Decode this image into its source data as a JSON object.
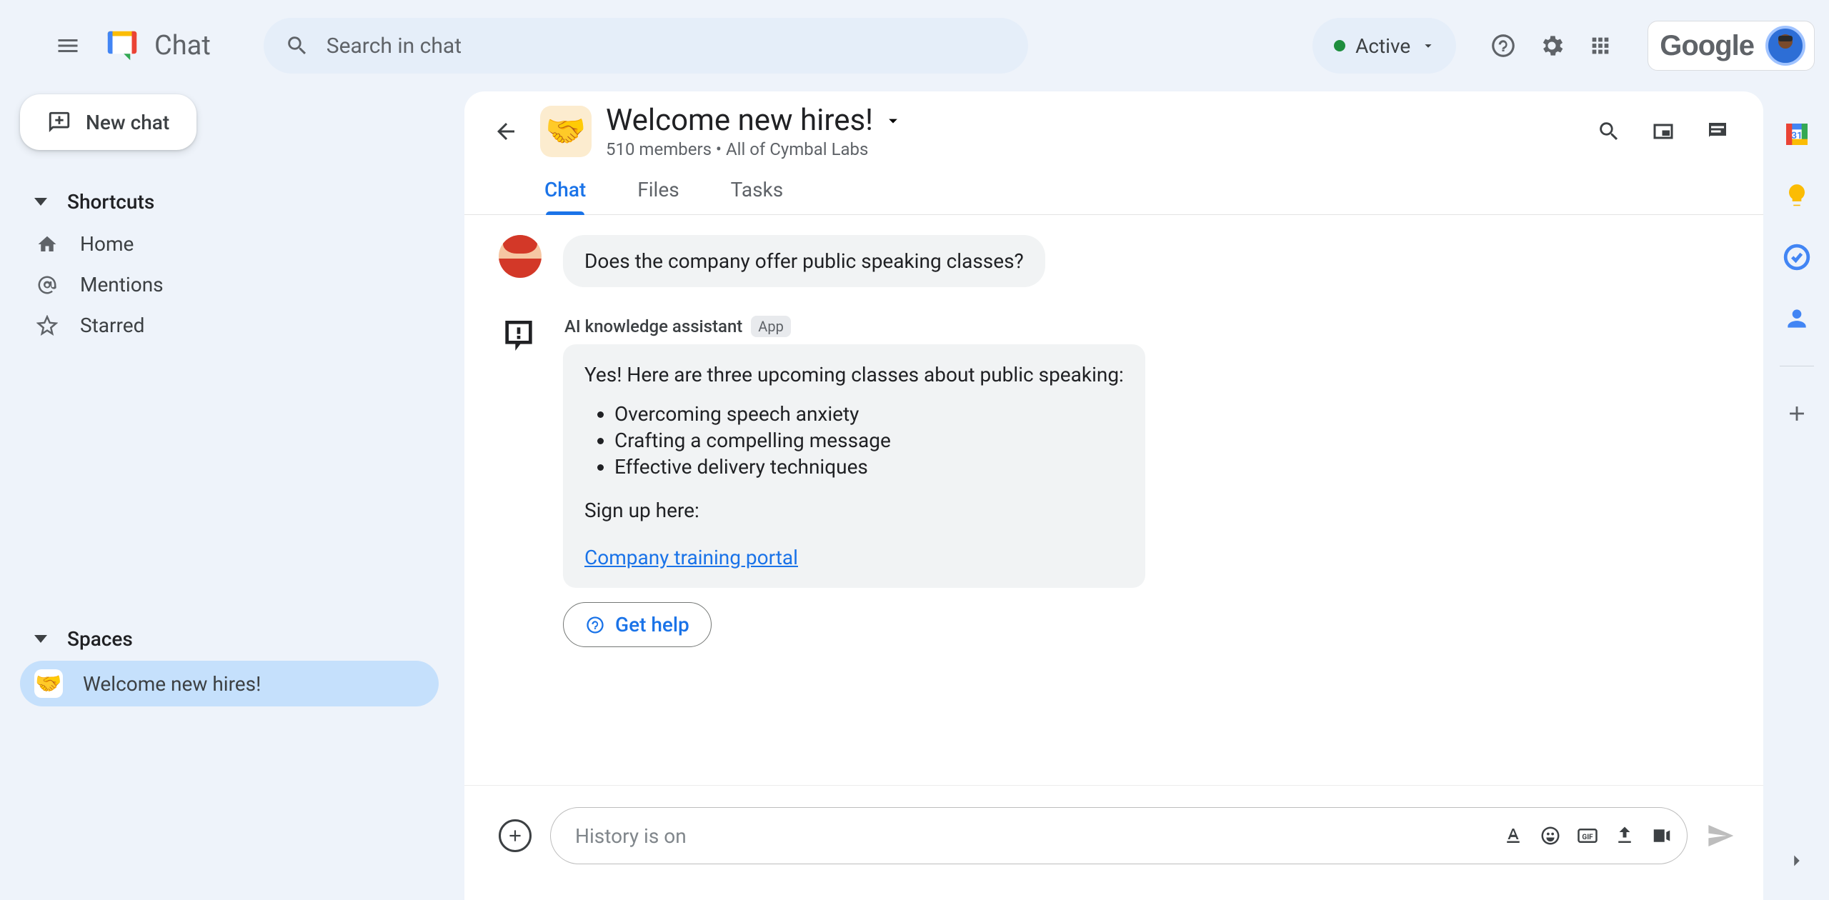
{
  "header": {
    "brand": "Chat",
    "search_placeholder": "Search in chat",
    "status_label": "Active",
    "google_word": "Google"
  },
  "left": {
    "new_chat": "New chat",
    "shortcuts_label": "Shortcuts",
    "shortcut_items": [
      "Home",
      "Mentions",
      "Starred"
    ],
    "spaces_label": "Spaces",
    "spaces": [
      {
        "emoji": "🤝",
        "name": "Welcome new hires!",
        "selected": true
      }
    ]
  },
  "space": {
    "emoji": "🤝",
    "title": "Welcome new hires!",
    "subtitle": "510 members  •  All of Cymbal Labs",
    "tabs": [
      "Chat",
      "Files",
      "Tasks"
    ],
    "active_tab": 0
  },
  "thread": {
    "user_msg": "Does the company offer public speaking classes?",
    "bot_name": "AI knowledge assistant",
    "bot_badge": "App",
    "bot_intro": "Yes! Here are three upcoming classes about public speaking:",
    "bot_list": [
      "Overcoming speech anxiety",
      "Crafting a compelling message",
      "Effective delivery techniques"
    ],
    "bot_signup": "Sign up here:",
    "bot_link": "Company training portal",
    "get_help": "Get help"
  },
  "composer": {
    "placeholder": "History is on"
  }
}
